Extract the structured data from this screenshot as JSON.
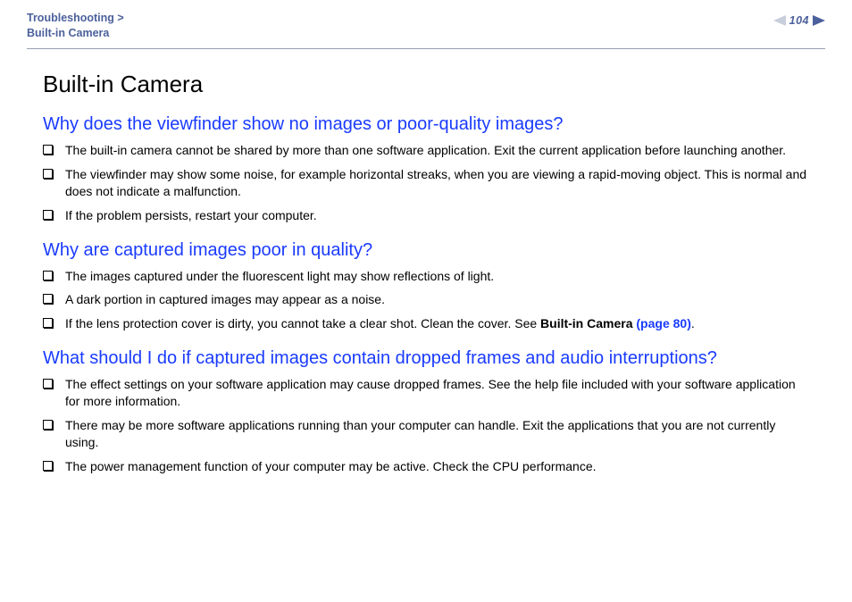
{
  "header": {
    "breadcrumb_line1": "Troubleshooting >",
    "breadcrumb_line2": "Built-in Camera",
    "page_number": "104"
  },
  "title": "Built-in Camera",
  "sections": [
    {
      "question": "Why does the viewfinder show no images or poor-quality images?",
      "items": [
        {
          "text": "The built-in camera cannot be shared by more than one software application. Exit the current application before launching another."
        },
        {
          "text": "The viewfinder may show some noise, for example horizontal streaks, when you are viewing a rapid-moving object. This is normal and does not indicate a malfunction."
        },
        {
          "text": "If the problem persists, restart your computer."
        }
      ]
    },
    {
      "question": "Why are captured images poor in quality?",
      "items": [
        {
          "text": "The images captured under the fluorescent light may show reflections of light."
        },
        {
          "text": "A dark portion in captured images may appear as a noise."
        },
        {
          "text": "If the lens protection cover is dirty, you cannot take a clear shot. Clean the cover. See ",
          "ref_bold": "Built-in Camera ",
          "ref_link": "(page 80)",
          "tail": "."
        }
      ]
    },
    {
      "question": "What should I do if captured images contain dropped frames and audio interruptions?",
      "items": [
        {
          "text": "The effect settings on your software application may cause dropped frames. See the help file included with your software application for more information."
        },
        {
          "text": "There may be more software applications running than your computer can handle. Exit the applications that you are not currently using."
        },
        {
          "text": "The power management function of your computer may be active. Check the CPU performance."
        }
      ]
    }
  ]
}
